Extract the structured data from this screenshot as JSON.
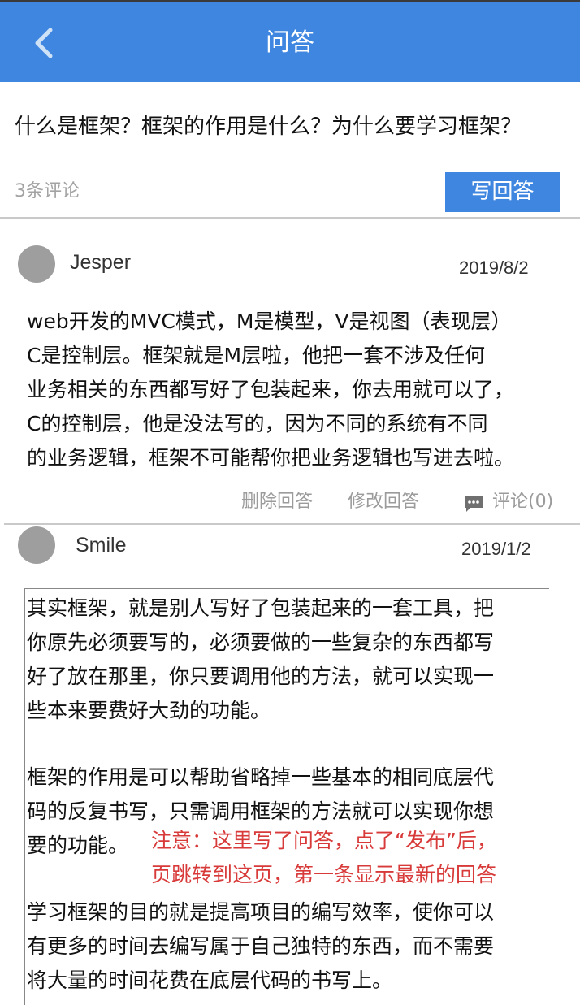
{
  "header": {
    "title": "问答",
    "back_icon": "chevron-left-icon"
  },
  "question": {
    "text": "什么是框架？框架的作用是什么？为什么要学习框架？",
    "comment_count": "3条评论",
    "write_answer_label": "写回答"
  },
  "answers": [
    {
      "user": "Jesper",
      "date": "2019/8/2",
      "lines": [
        "web开发的MVC模式，M是模型，V是视图（表现层）",
        "C是控制层。框架就是M层啦，他把一套不涉及任何",
        "业务相关的东西都写好了包装起来，你去用就可以了，",
        "C的控制层，他是没法写的，因为不同的系统有不同",
        "的业务逻辑，框架不可能帮你把业务逻辑也写进去啦。"
      ],
      "actions": {
        "delete_label": "删除回答",
        "edit_label": "修改回答",
        "comment_label": "评论(0)",
        "comment_icon": "chat-bubble-icon"
      }
    },
    {
      "user": "Smile",
      "date": "2019/1/2",
      "paragraphs": [
        [
          "其实框架，就是别人写好了包装起来的一套工具，把",
          "你原先必须要写的，必须要做的一些复杂的东西都写",
          "好了放在那里，你只要调用他的方法，就可以实现一",
          "些本来要费好大劲的功能。"
        ],
        [
          "框架的作用是可以帮助省略掉一些基本的相同底层代",
          "码的反复书写，只需调用框架的方法就可以实现你想",
          "要的功能。"
        ],
        [
          "学习框架的目的就是提高项目的编写效率，使你可以",
          "有更多的时间去编写属于自己独特的东西，而不需要",
          "将大量的时间花费在底层代码的书写上。"
        ]
      ]
    }
  ],
  "annotation": {
    "line1": "注意：这里写了问答，点了“发布”后，",
    "line2": "页跳转到这页，第一条显示最新的回答",
    "color": "#d83a3a"
  },
  "colors": {
    "accent": "#3f86e0",
    "muted": "#a3a3a3",
    "avatar": "#9e9e9e"
  }
}
